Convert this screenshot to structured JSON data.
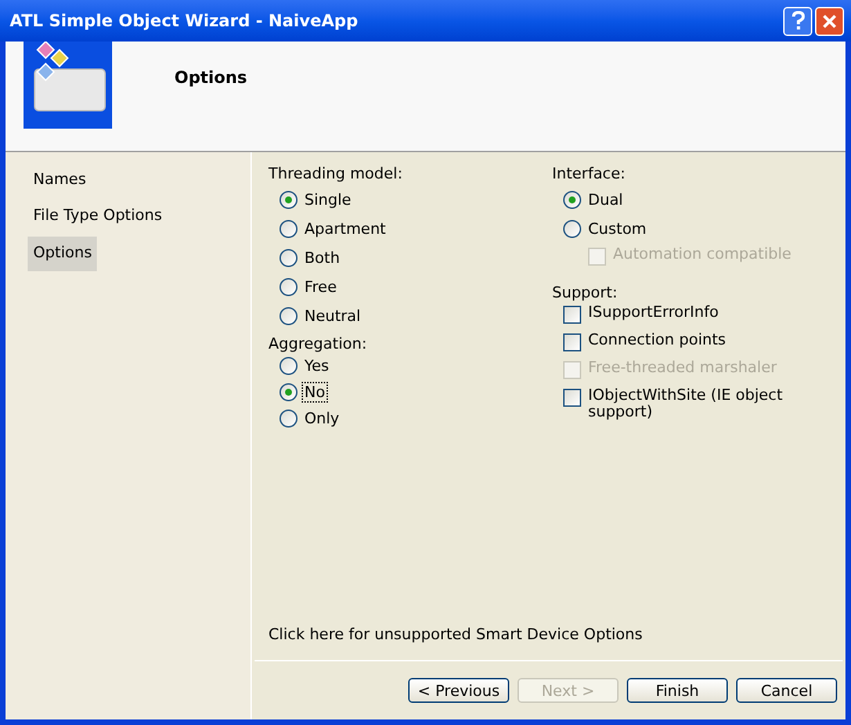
{
  "window": {
    "title": "ATL Simple Object Wizard - NaiveApp"
  },
  "header": {
    "title": "Options"
  },
  "sidebar": {
    "items": [
      {
        "label": "Names",
        "selected": false
      },
      {
        "label": "File Type Options",
        "selected": false
      },
      {
        "label": "Options",
        "selected": true
      }
    ]
  },
  "threading_model": {
    "label": "Threading model:",
    "options": [
      {
        "label": "Single",
        "selected": true
      },
      {
        "label": "Apartment",
        "selected": false
      },
      {
        "label": "Both",
        "selected": false
      },
      {
        "label": "Free",
        "selected": false
      },
      {
        "label": "Neutral",
        "selected": false
      }
    ]
  },
  "aggregation": {
    "label": "Aggregation:",
    "options": [
      {
        "label": "Yes",
        "selected": false,
        "focused": false
      },
      {
        "label": "No",
        "selected": true,
        "focused": true
      },
      {
        "label": "Only",
        "selected": false,
        "focused": false
      }
    ]
  },
  "interface": {
    "label": "Interface:",
    "options": [
      {
        "label": "Dual",
        "selected": true
      },
      {
        "label": "Custom",
        "selected": false
      }
    ],
    "automation": {
      "label": "Automation compatible",
      "checked": false,
      "disabled": true
    }
  },
  "support": {
    "label": "Support:",
    "options": [
      {
        "label": "ISupportErrorInfo",
        "checked": false,
        "disabled": false
      },
      {
        "label": "Connection points",
        "checked": false,
        "disabled": false
      },
      {
        "label": "Free-threaded marshaler",
        "checked": false,
        "disabled": true
      },
      {
        "label": "IObjectWithSite (IE object support)",
        "checked": false,
        "disabled": false
      }
    ]
  },
  "smart_device_link": "Click here for unsupported Smart Device Options",
  "buttons": [
    {
      "label": "< Previous",
      "disabled": false
    },
    {
      "label": "Next >",
      "disabled": true
    },
    {
      "label": "Finish",
      "disabled": false
    },
    {
      "label": "Cancel",
      "disabled": false
    }
  ]
}
